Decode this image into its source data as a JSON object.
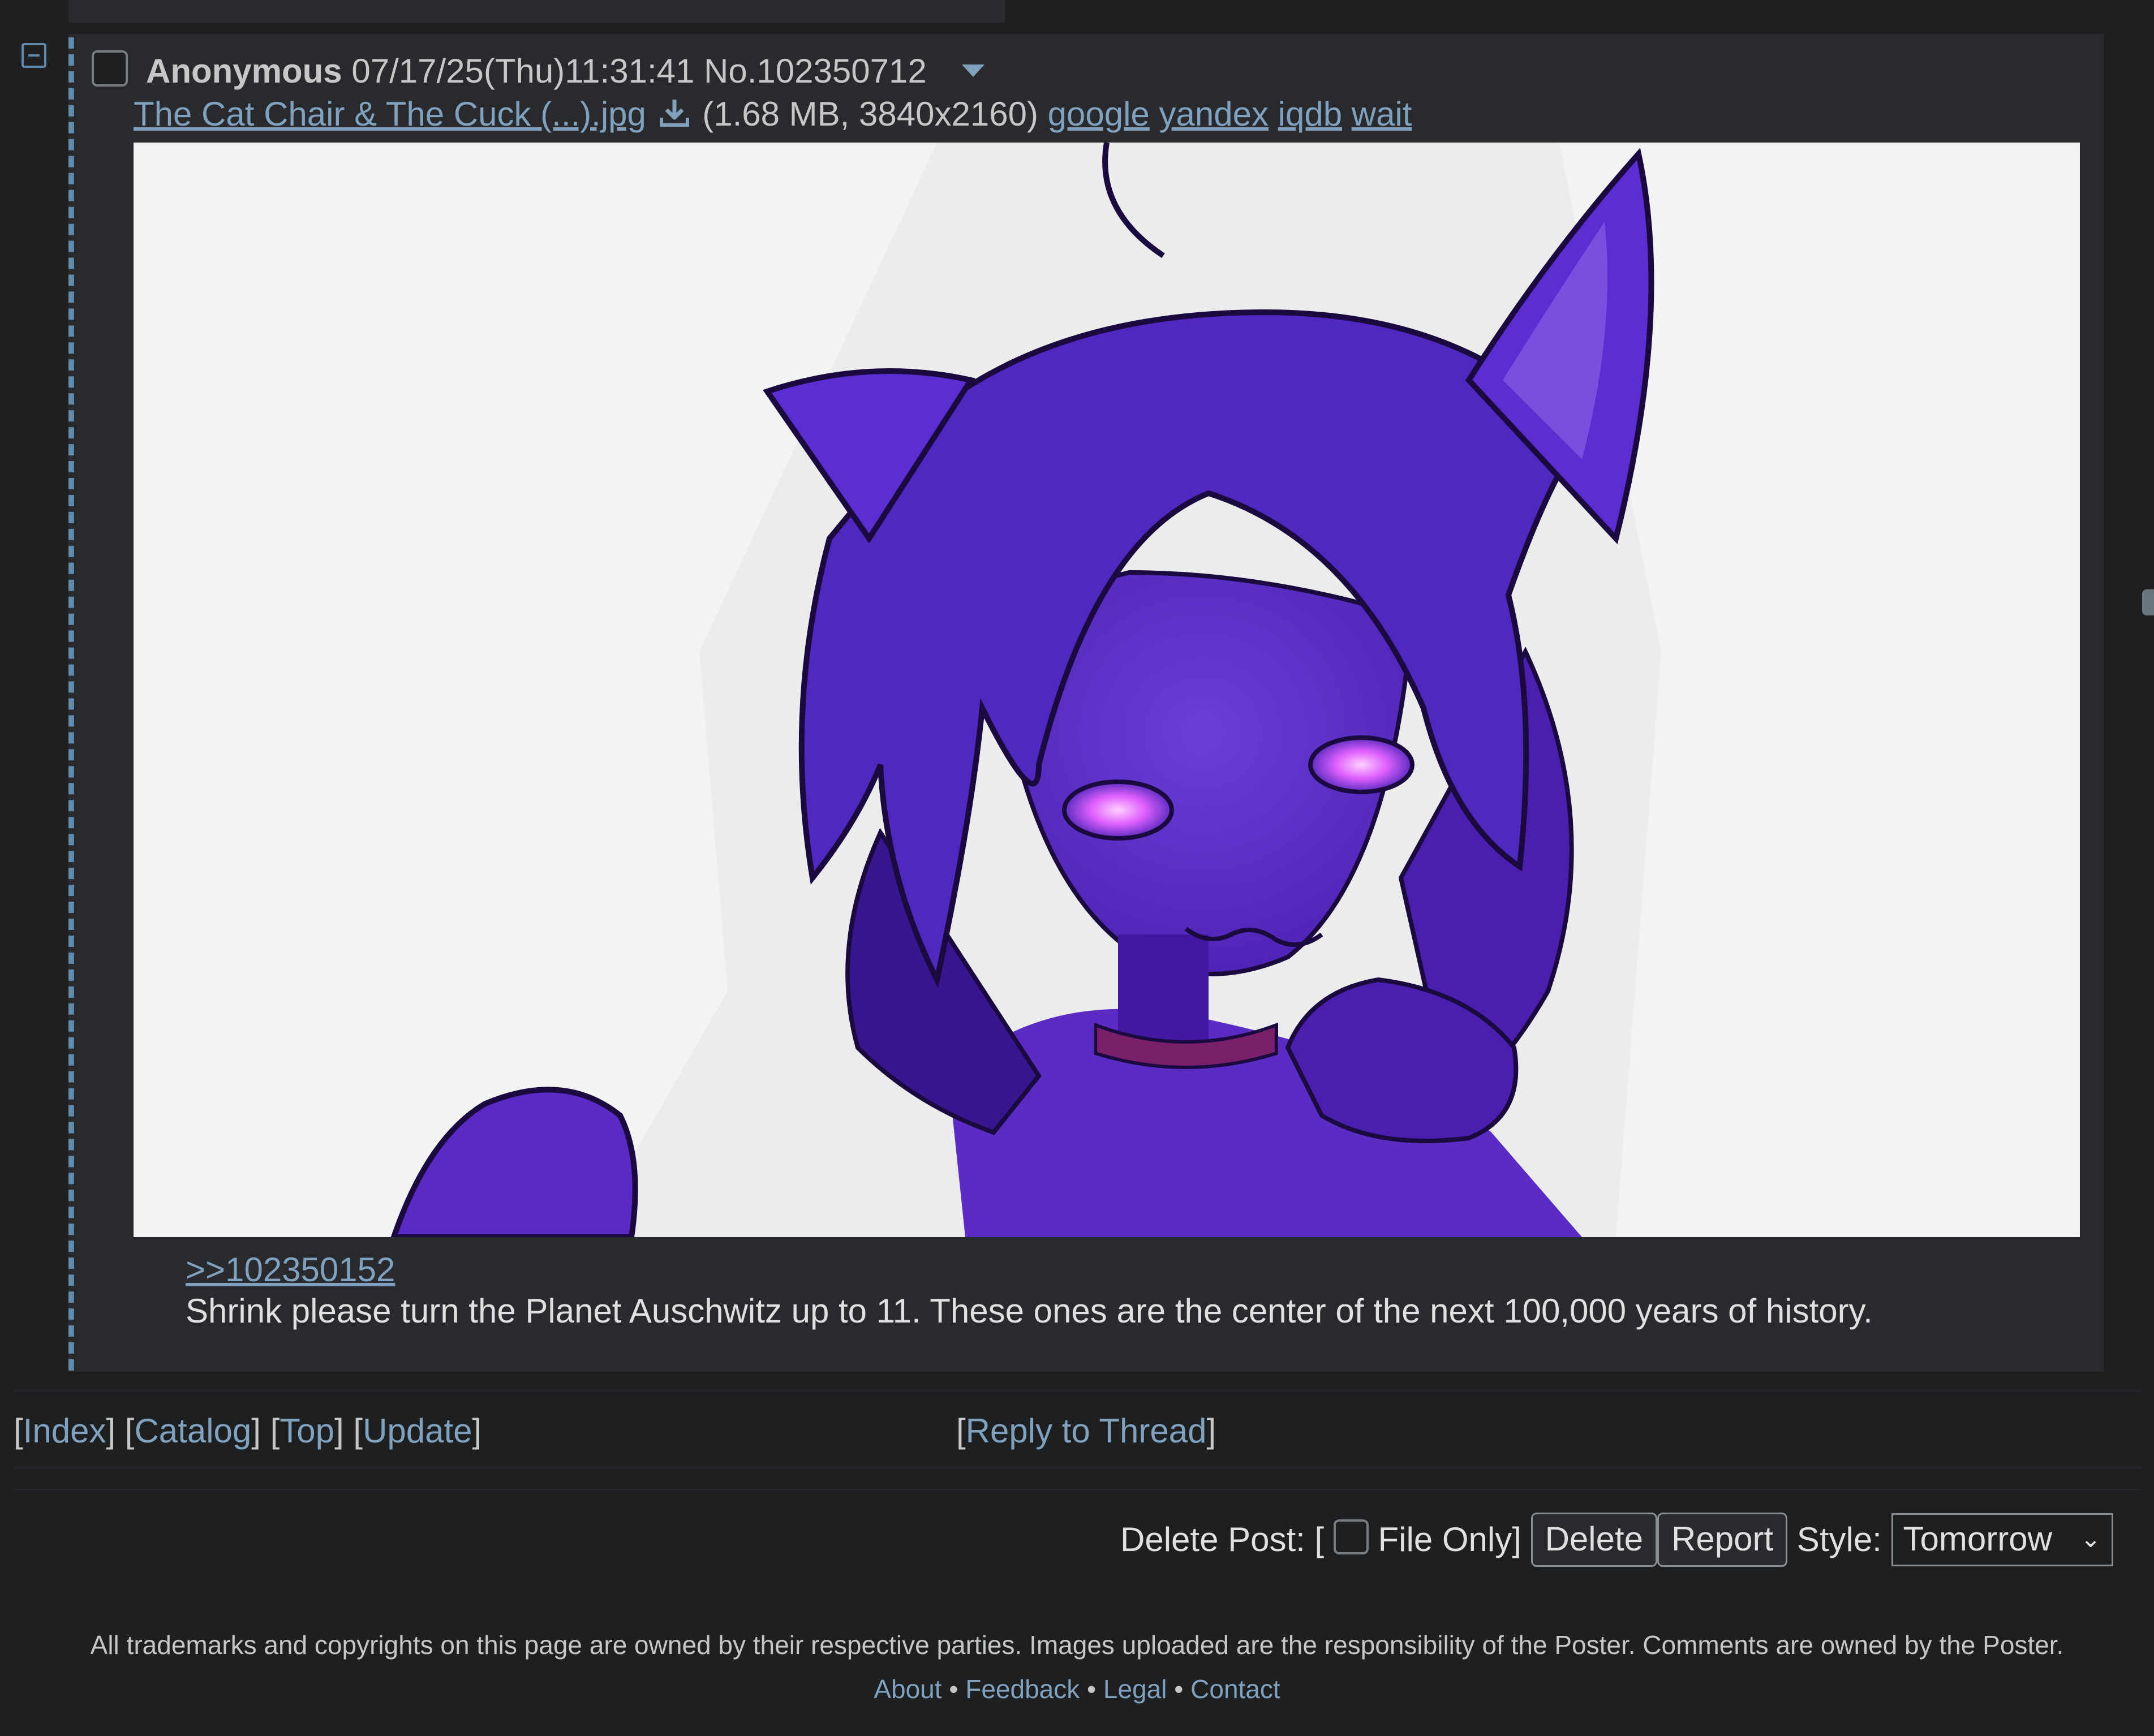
{
  "post": {
    "name": "Anonymous",
    "datetime": "07/17/25(Thu)11:31:41",
    "number": "No.102350712",
    "file": {
      "filename": "The Cat Chair & The Cuck (...).jpg",
      "meta": "(1.68 MB, 3840x2160)",
      "search_links": [
        "google",
        "yandex",
        "iqdb",
        "wait"
      ]
    },
    "quote": ">>102350152",
    "comment": "Shrink please turn the Planet Auschwitz up to 11. These ones are the center of the next 100,000 years of history."
  },
  "nav": {
    "index": "Index",
    "catalog": "Catalog",
    "top": "Top",
    "update": "Update",
    "reply": "Reply to Thread"
  },
  "delete": {
    "label": "Delete Post: [",
    "file_only": "File Only]",
    "delete_btn": "Delete",
    "report_btn": "Report",
    "style_label": "Style:",
    "style_value": "Tomorrow"
  },
  "footer": {
    "note": "All trademarks and copyrights on this page are owned by their respective parties. Images uploaded are the responsibility of the Poster. Comments are owned by the Poster.",
    "links": [
      "About",
      "Feedback",
      "Legal",
      "Contact"
    ],
    "separator": "•"
  },
  "colors": {
    "background": "#1d1f21",
    "post_bg": "#282a2e",
    "link": "#81a2be",
    "text": "#c5c8c6"
  }
}
